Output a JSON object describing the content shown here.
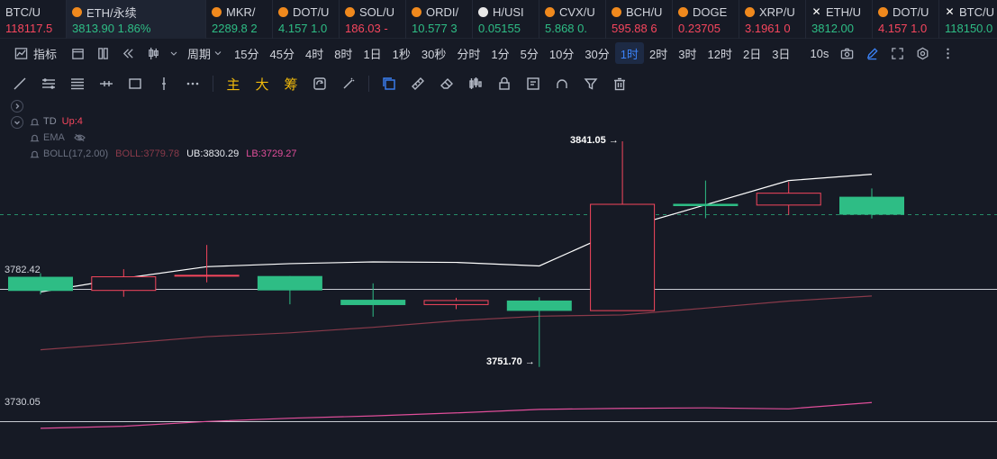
{
  "tickers": [
    {
      "symbol": "BTC/U",
      "value": "118117.5",
      "dir": "down",
      "icon": "none"
    },
    {
      "symbol": "ETH/永续",
      "value": "3813.90  1.86%",
      "dir": "up",
      "icon": "orange",
      "active": true
    },
    {
      "symbol": "MKR/",
      "value": "2289.8  2",
      "dir": "up",
      "icon": "orange"
    },
    {
      "symbol": "DOT/U",
      "value": "4.157  1.0",
      "dir": "up",
      "icon": "orange"
    },
    {
      "symbol": "SOL/U",
      "value": "186.03  -",
      "dir": "down",
      "icon": "orange"
    },
    {
      "symbol": "ORDI/",
      "value": "10.577  3",
      "dir": "up",
      "icon": "orange"
    },
    {
      "symbol": "H/USI",
      "value": "0.05155",
      "dir": "up",
      "icon": "white"
    },
    {
      "symbol": "CVX/U",
      "value": "5.868  0.",
      "dir": "up",
      "icon": "orange"
    },
    {
      "symbol": "BCH/U",
      "value": "595.88  6",
      "dir": "down",
      "icon": "orange"
    },
    {
      "symbol": "DOGE",
      "value": "0.23705",
      "dir": "down",
      "icon": "orange"
    },
    {
      "symbol": "XRP/U",
      "value": "3.1961  0",
      "dir": "down",
      "icon": "orange"
    },
    {
      "symbol": "ETH/U",
      "value": "3812.00",
      "dir": "up",
      "icon": "x"
    },
    {
      "symbol": "DOT/U",
      "value": "4.157  1.0",
      "dir": "down",
      "icon": "orange"
    },
    {
      "symbol": "BTC/U",
      "value": "118150.0",
      "dir": "up",
      "icon": "x"
    }
  ],
  "toolbar": {
    "indicator_label": "指标",
    "period_label": "周期",
    "periods": [
      "15分",
      "45分",
      "4时",
      "8时",
      "1日",
      "1秒",
      "30秒",
      "分时",
      "1分",
      "5分",
      "10分",
      "30分",
      "1时",
      "2时",
      "3时",
      "12时",
      "2日",
      "3日"
    ],
    "selected_period": "1时",
    "replay_label": "10s"
  },
  "drawing_tools": {
    "main_label": "主",
    "big_label": "大",
    "chip_label": "筹"
  },
  "legend": {
    "td_name": "TD",
    "td_value": "Up:4",
    "ema_name": "EMA",
    "boll_name": "BOLL(17,2.00)",
    "boll_mid": "BOLL:3779.78",
    "boll_ub": "UB:3830.29",
    "boll_lb": "LB:3729.27"
  },
  "price_lines": {
    "upper": "3782.42",
    "lower": "3730.05"
  },
  "annotations": {
    "high": "3841.05 →",
    "low": "3751.70 →"
  },
  "colors": {
    "up": "#2ebd85",
    "down": "#f6465d",
    "accent": "#3b82f6",
    "boll_mid": "#ffffff",
    "boll_lb": "#e04e9a"
  },
  "chart_data": {
    "type": "candlestick",
    "interval": "1时",
    "candles": [
      {
        "open": 3787.4,
        "high": 3788.8,
        "low": 3780.4,
        "close": 3781.8,
        "dir": "up"
      },
      {
        "open": 3782.0,
        "high": 3790.4,
        "low": 3779.5,
        "close": 3787.4,
        "dir": "down"
      },
      {
        "open": 3788.0,
        "high": 3800.0,
        "low": 3785.2,
        "close": 3788.0,
        "dir": "down"
      },
      {
        "open": 3787.7,
        "high": 3787.7,
        "low": 3776.5,
        "close": 3782.0,
        "dir": "up"
      },
      {
        "open": 3778.3,
        "high": 3784.8,
        "low": 3771.6,
        "close": 3776.2,
        "dir": "up"
      },
      {
        "open": 3776.4,
        "high": 3779.1,
        "low": 3774.6,
        "close": 3778.0,
        "dir": "down"
      },
      {
        "open": 3778.0,
        "high": 3779.3,
        "low": 3751.7,
        "close": 3773.9,
        "dir": "up"
      },
      {
        "open": 3774.0,
        "high": 3841.05,
        "low": 3774.0,
        "close": 3816.1,
        "dir": "down"
      },
      {
        "open": 3815.4,
        "high": 3825.5,
        "low": 3810.6,
        "close": 3816.3,
        "dir": "up"
      },
      {
        "open": 3815.8,
        "high": 3825.0,
        "low": 3811.9,
        "close": 3820.5,
        "dir": "down"
      },
      {
        "open": 3819.1,
        "high": 3822.4,
        "low": 3810.5,
        "close": 3812.0,
        "dir": "up"
      }
    ],
    "boll_ub": [
      3781.4,
      3786.8,
      3791.4,
      3792.6,
      3793.3,
      3793.1,
      3791.7,
      3806.4,
      3815.9,
      3825.5,
      3828.0
    ],
    "boll_mid": [
      3758.5,
      3761.0,
      3763.7,
      3765.2,
      3767.4,
      3770.0,
      3771.8,
      3772.3,
      3775.0,
      3777.8,
      3779.8
    ],
    "boll_lb": [
      3727.4,
      3728.2,
      3730.1,
      3731.4,
      3732.3,
      3733.5,
      3734.9,
      3735.3,
      3735.5,
      3735.1,
      3737.6
    ]
  }
}
